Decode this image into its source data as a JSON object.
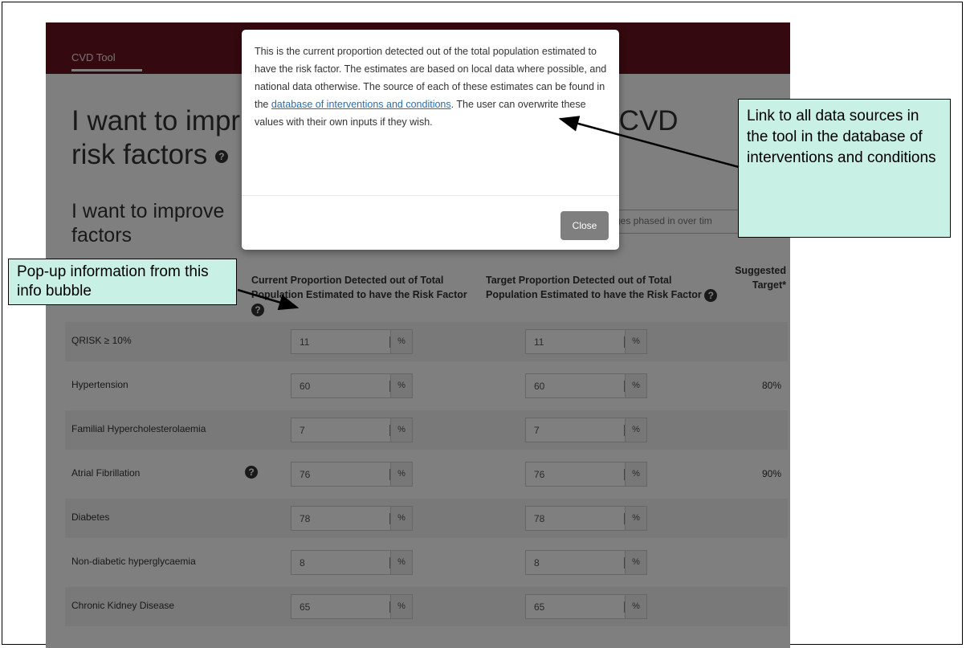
{
  "app": {
    "nav_tab": "CVD Tool",
    "heading_left_1": "I want to impr",
    "heading_left_2": "risk factors",
    "heading_right": "f key CVD",
    "subheading_1": "I want to improve",
    "subheading_2": "factors",
    "phase_text": "ges phased in over tim",
    "col_current": "Current Proportion Detected out of Total Population Estimated to have the Risk Factor",
    "col_target": "Target Proportion Detected out of Total Population Estimated to have the Risk Factor",
    "col_suggest": "Suggested Target*",
    "percent_symbol": "%",
    "rows": [
      {
        "label": "QRISK ≥ 10%",
        "current": "11",
        "target": "11",
        "suggested": ""
      },
      {
        "label": "Hypertension",
        "current": "60",
        "target": "60",
        "suggested": "80%"
      },
      {
        "label": "Familial Hypercholesterolaemia",
        "current": "7",
        "target": "7",
        "suggested": ""
      },
      {
        "label": "Atrial Fibrillation",
        "current": "76",
        "target": "76",
        "suggested": "90%"
      },
      {
        "label": "Diabetes",
        "current": "78",
        "target": "78",
        "suggested": ""
      },
      {
        "label": "Non-diabetic hyperglycaemia",
        "current": "8",
        "target": "8",
        "suggested": ""
      },
      {
        "label": "Chronic Kidney Disease",
        "current": "65",
        "target": "65",
        "suggested": ""
      }
    ]
  },
  "modal": {
    "body_before_link": "This is the current proportion detected out of the total population estimated to have the risk factor. The estimates are based on local data where possible, and national data otherwise. The source of each of these estimates can be found in the ",
    "link_text": "database of interventions and conditions",
    "body_after_link": ". The user can overwrite these values with their own inputs if they wish.",
    "close_label": "Close"
  },
  "annotations": {
    "right": "Link to all data sources in the tool in the database of interventions and conditions",
    "left": "Pop-up information from this info bubble"
  },
  "icons": {
    "info": "question-circle-icon",
    "spinner": "number-spinner-icon"
  }
}
